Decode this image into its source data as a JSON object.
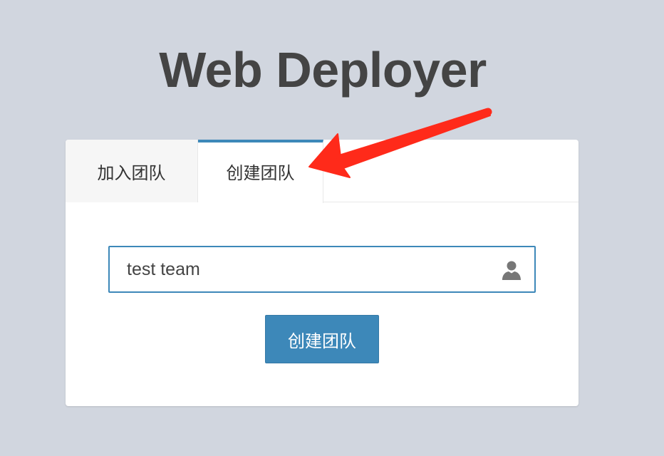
{
  "app": {
    "title": "Web Deployer"
  },
  "tabs": [
    {
      "label": "加入团队",
      "active": false
    },
    {
      "label": "创建团队",
      "active": true
    }
  ],
  "team_input": {
    "value": "test team",
    "icon": "user-icon"
  },
  "create_button": {
    "label": "创建团队"
  },
  "colors": {
    "background": "#d1d6df",
    "accent": "#3d88b9",
    "annotation": "#ff2a1a",
    "title": "#444444"
  }
}
